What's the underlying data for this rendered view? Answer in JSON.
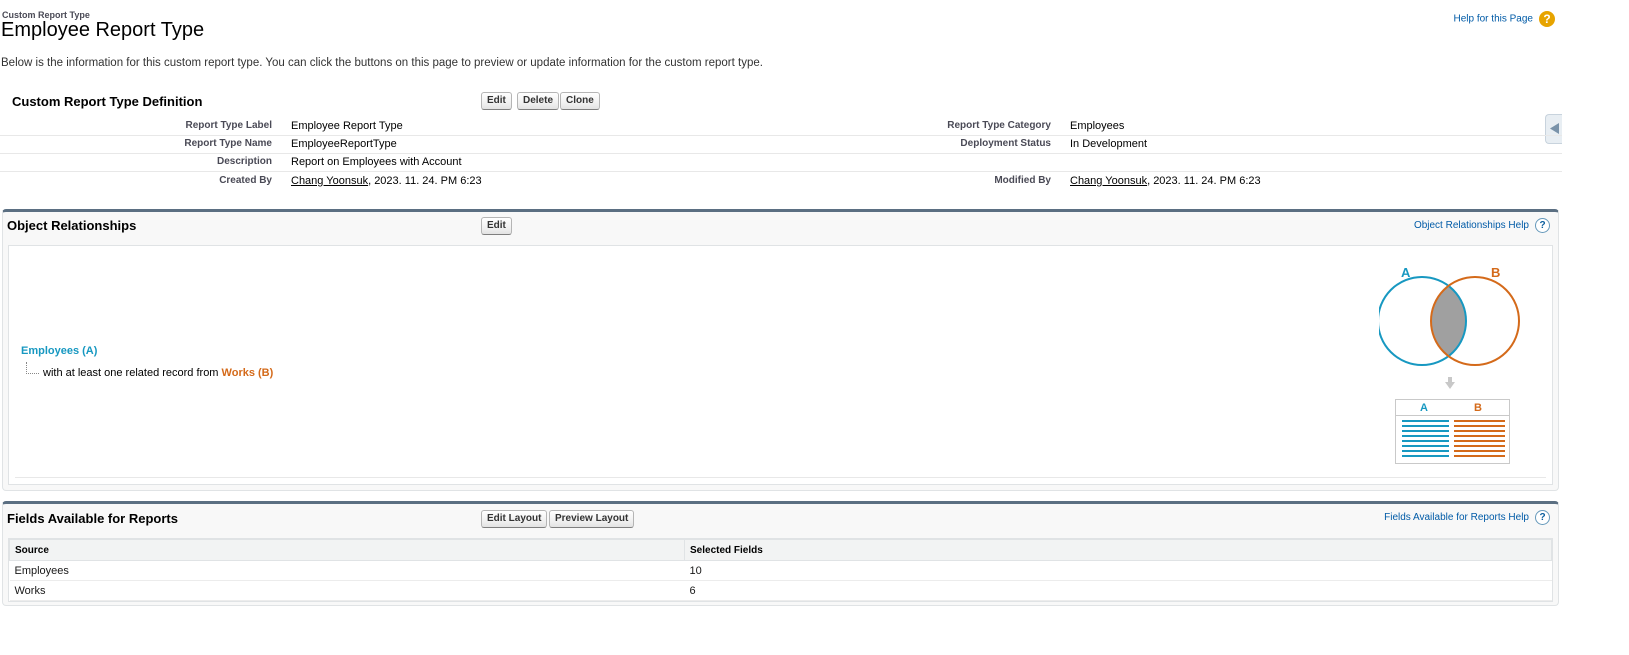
{
  "header": {
    "breadcrumb": "Custom Report Type",
    "title": "Employee Report Type",
    "help_link": "Help for this Page",
    "description": "Below is the information for this custom report type. You can click the buttons on this page to preview or update information for the custom report type."
  },
  "definition": {
    "title": "Custom Report Type Definition",
    "buttons": {
      "edit": "Edit",
      "delete": "Delete",
      "clone": "Clone"
    },
    "rows": {
      "label_label": "Report Type Label",
      "label_value": "Employee Report Type",
      "category_label": "Report Type Category",
      "category_value": "Employees",
      "name_label": "Report Type Name",
      "name_value": "EmployeeReportType",
      "status_label": "Deployment Status",
      "status_value": "In Development",
      "description_label": "Description",
      "description_value": "Report on Employees with Account",
      "created_label": "Created By",
      "created_user": "Chang Yoonsuk",
      "created_date": ", 2023. 11. 24. PM 6:23",
      "modified_label": "Modified By",
      "modified_user": "Chang Yoonsuk",
      "modified_date": ", 2023. 11. 24. PM 6:23"
    }
  },
  "relationships": {
    "title": "Object Relationships",
    "edit_button": "Edit",
    "help_link": "Object Relationships Help",
    "primary_object": "Employees (A)",
    "relation_text": "with at least one related record from",
    "secondary_object": "Works (B)",
    "diagram": {
      "label_a": "A",
      "label_b": "B",
      "color_a": "#1798c1",
      "color_b": "#d46a1a",
      "intersection_color": "#a0a0a0"
    }
  },
  "fields": {
    "title": "Fields Available for Reports",
    "edit_layout_button": "Edit Layout",
    "preview_layout_button": "Preview Layout",
    "help_link": "Fields Available for Reports Help",
    "columns": {
      "source": "Source",
      "selected": "Selected Fields"
    },
    "rows": [
      {
        "source": "Employees",
        "selected": "10"
      },
      {
        "source": "Works",
        "selected": "6"
      }
    ]
  },
  "icons": {
    "help": "help-icon",
    "collapse_tab": "sidebar-collapse-icon",
    "arrow": "arrow-down-icon"
  }
}
